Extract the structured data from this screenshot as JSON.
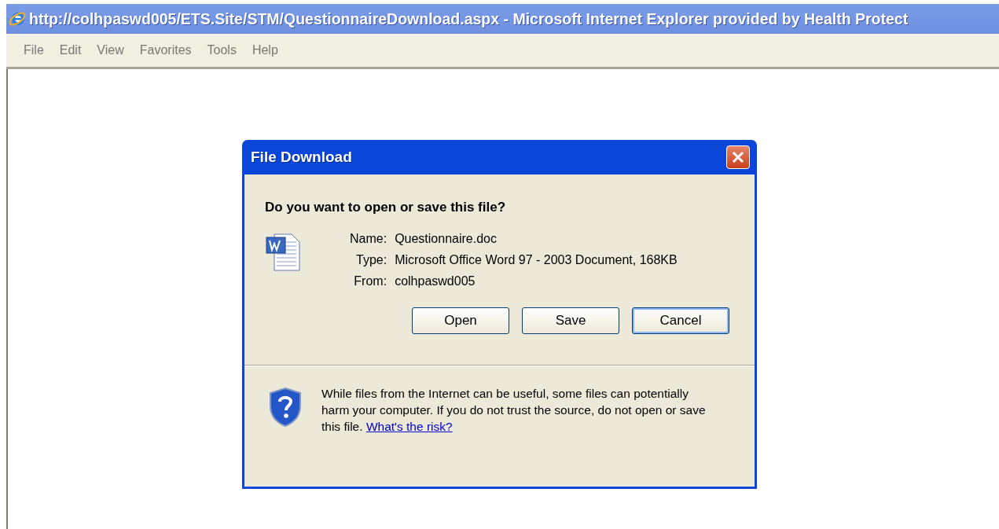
{
  "window": {
    "title": "http://colhpaswd005/ETS.Site/STM/QuestionnaireDownload.aspx - Microsoft Internet Explorer provided by Health Protect"
  },
  "menu": [
    "File",
    "Edit",
    "View",
    "Favorites",
    "Tools",
    "Help"
  ],
  "dialog": {
    "title": "File Download",
    "question": "Do you want to open or save this file?",
    "details": [
      {
        "label": "Name:",
        "value": "Questionnaire.doc"
      },
      {
        "label": "Type:",
        "value": "Microsoft Office Word 97 - 2003 Document, 168KB"
      },
      {
        "label": "From:",
        "value": "colhpaswd005"
      }
    ],
    "buttons": [
      {
        "label": "Open",
        "default": false
      },
      {
        "label": "Save",
        "default": false
      },
      {
        "label": "Cancel",
        "default": true
      }
    ],
    "warning": "While files from the Internet can be useful, some files can potentially harm your computer. If you do not trust the source, do not open or save this file.",
    "risk_link": "What's the risk?"
  }
}
